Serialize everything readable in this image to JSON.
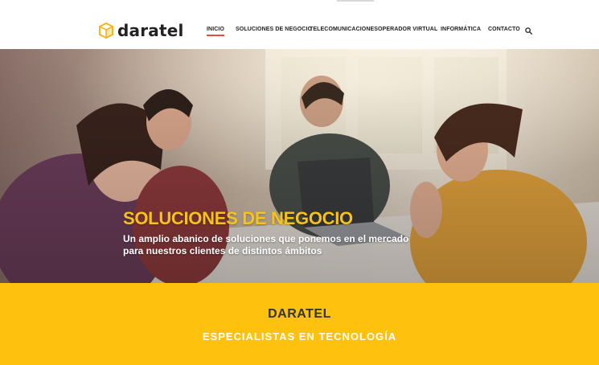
{
  "brand": {
    "name": "daratel",
    "accent_color": "#f6b619"
  },
  "nav": {
    "items": [
      {
        "label": "INICIO",
        "active": true
      },
      {
        "label": "SOLUCIONES DE NEGOCIO",
        "active": false
      },
      {
        "label": "TELECOMUNICACIONES",
        "active": false
      },
      {
        "label": "OPERADOR VIRTUAL",
        "active": false
      },
      {
        "label": "INFORMÁTICA",
        "active": false
      },
      {
        "label": "CONTACTO",
        "active": false
      }
    ],
    "search_icon": "search-icon",
    "active_underline_color": "#e84c3d"
  },
  "hero": {
    "title": "SOLUCIONES DE NEGOCIO",
    "subtitle_line1": "Un amplio abanico de soluciones que ponemos en el mercado",
    "subtitle_line2": "para nuestros clientes de distintos ámbitos",
    "title_color": "#f6c21b"
  },
  "band": {
    "title": "DARATEL",
    "subtitle": "ESPECIALISTAS EN TECNOLOGÍA",
    "background": "#fec20e"
  }
}
